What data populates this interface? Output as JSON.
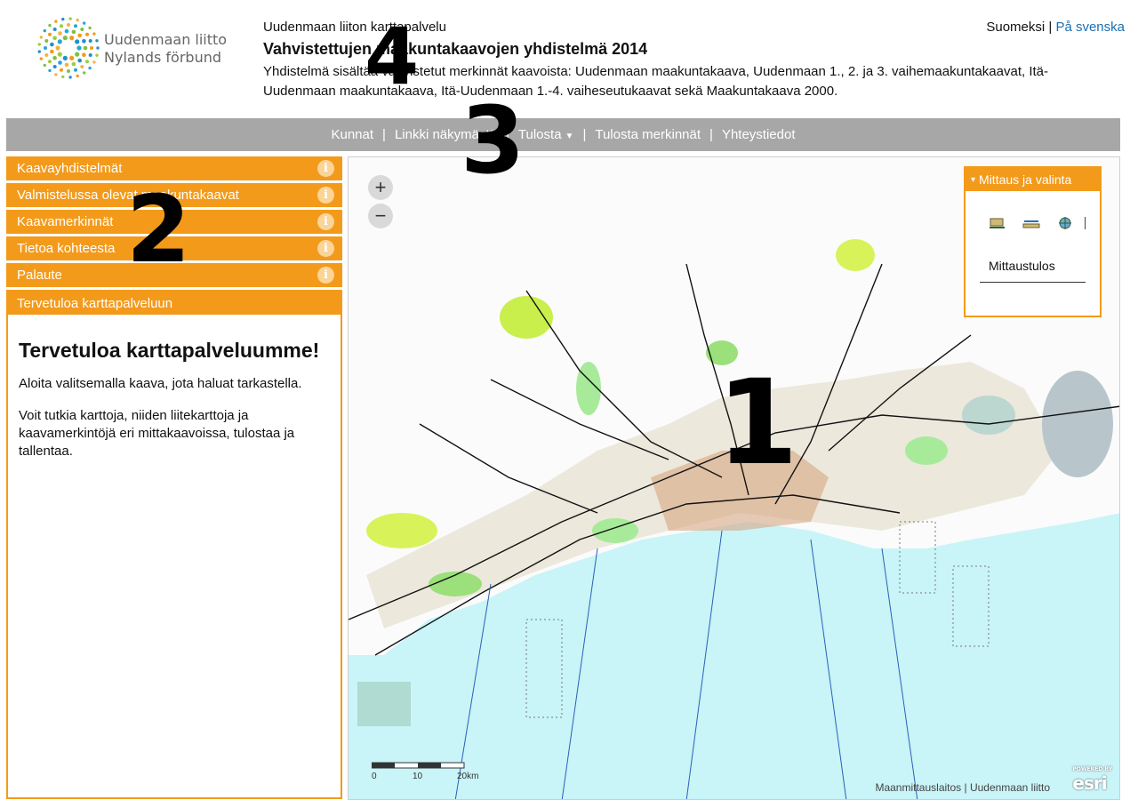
{
  "header": {
    "logo_line1": "Uudenmaan liitto",
    "logo_line2": "Nylands förbund",
    "service_name": "Uudenmaan liiton karttapalvelu",
    "title": "Vahvistettujen maakuntakaavojen yhdistelmä 2014",
    "description": "Yhdistelmä sisältää vahvistetut merkinnät kaavoista: Uudenmaan maakuntakaava, Uudenmaan 1., 2. ja 3. vaihemaakuntakaavat, Itä-Uudenmaan maakuntakaava, Itä-Uudenmaan 1.-4. vaiheseutukaavat sekä Maakuntakaava 2000."
  },
  "lang": {
    "fi": "Suomeksi",
    "sep": "|",
    "sv": "På svenska"
  },
  "topnav": {
    "items": [
      "Kunnat",
      "Linkki näkymästä",
      "Tulosta",
      "Tulosta merkinnät",
      "Yhteystiedot"
    ],
    "sep": "|"
  },
  "sidebar": {
    "sections": [
      "Kaavayhdistelmät",
      "Valmistelussa olevat maakuntakaavat",
      "Kaavamerkinnät",
      "Tietoa kohteesta",
      "Palaute"
    ],
    "info_glyph": "i",
    "welcome_header": "Tervetuloa karttapalveluun",
    "welcome_title": "Tervetuloa karttapalveluumme!",
    "welcome_p1": "Aloita valitsemalla kaava, jota haluat tarkastella.",
    "welcome_p2": "Voit tutkia karttoja, niiden liitekarttoja ja kaavamerkintöjä eri mittakaavoissa, tulostaa ja tallentaa."
  },
  "map": {
    "zoom_in": "+",
    "zoom_out": "−",
    "scale_labels": [
      "0",
      "10",
      "20km"
    ],
    "attribution": "Maanmittauslaitos | Uudenmaan liitto",
    "esri_small": "POWERED BY",
    "esri": "esri",
    "measure": {
      "title": "Mittaus ja valinta",
      "caret": "▾",
      "result_label": "Mittaustulos",
      "tools": [
        "area-measure-icon",
        "distance-measure-icon",
        "location-icon"
      ]
    }
  },
  "annotations": [
    "1",
    "2",
    "3",
    "4"
  ],
  "colors": {
    "accent": "#f39a1b",
    "nav_bg": "#a7a7a7",
    "sea": "#c8f4f8",
    "link": "#1a6fb3"
  }
}
